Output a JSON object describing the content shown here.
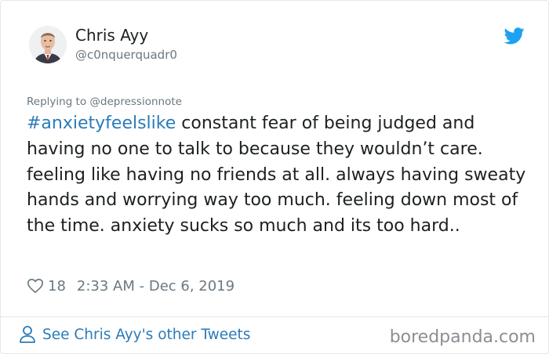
{
  "author": {
    "display_name": "Chris Ayy",
    "handle": "@c0nquerquadr0",
    "avatar_icon": "profile-photo"
  },
  "tweet": {
    "replying_to": "Replying to @depressionnote",
    "hashtag": "#anxietyfeelslike",
    "body": " constant fear of being judged and having no one to talk to because they wouldn’t care. feeling like having no friends at all. always having sweaty hands and worrying way too much. feeling down most of the time. anxiety sucks so much and its too hard..",
    "likes": "18",
    "timestamp": "2:33 AM - Dec 6, 2019"
  },
  "footer": {
    "see_more": "See Chris Ayy's other Tweets",
    "watermark": "boredpanda.com"
  },
  "colors": {
    "link": "#2b7bb9",
    "twitter_blue": "#1da1f2",
    "muted": "#697882",
    "text": "#1c2022",
    "border": "#e1e8ed"
  },
  "icons": {
    "brand": "twitter-bird-icon",
    "like": "heart-icon",
    "profile": "person-icon"
  }
}
